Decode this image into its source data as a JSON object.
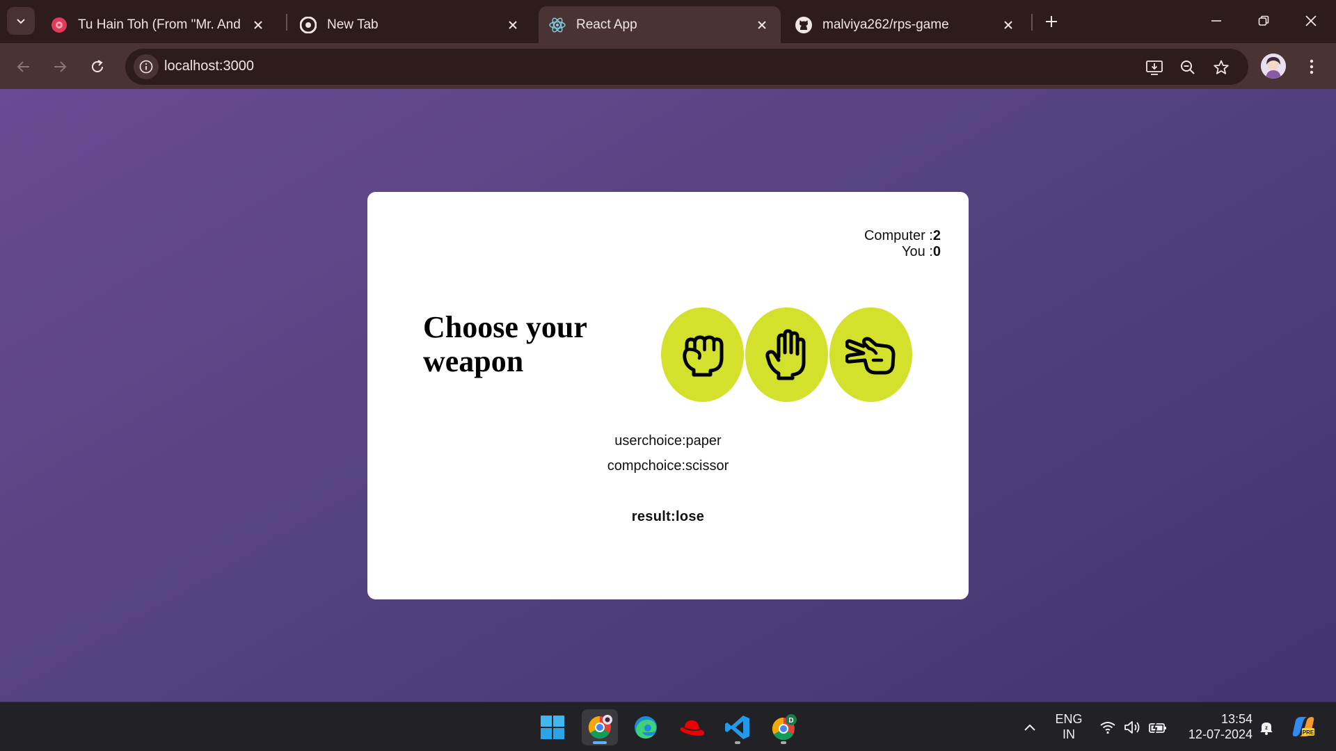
{
  "browser": {
    "tabs": [
      {
        "title": "Tu Hain Toh (From \"Mr. And Mrs. Mahi\")",
        "icon": "music-icon",
        "active": false
      },
      {
        "title": "New Tab",
        "icon": "chrome-icon",
        "active": false
      },
      {
        "title": "React App",
        "icon": "react-icon",
        "active": true
      },
      {
        "title": "malviya262/rps-game",
        "icon": "github-icon",
        "active": false
      }
    ],
    "url": "localhost:3000"
  },
  "game": {
    "score": {
      "computer_label": "Computer :",
      "computer_value": "2",
      "you_label": "You :",
      "you_value": "0"
    },
    "heading": "Choose your weapon",
    "weapons": [
      {
        "name": "rock",
        "icon": "fist-icon"
      },
      {
        "name": "paper",
        "icon": "palm-icon"
      },
      {
        "name": "scissor",
        "icon": "scissors-hand-icon"
      }
    ],
    "user_choice": "userchoice:paper",
    "comp_choice": "compchoice:scissor",
    "result": "result:lose"
  },
  "colors": {
    "weapon_bg": "#d4e12c",
    "page_gradient_start": "#6a4a93",
    "page_gradient_end": "#45336f",
    "browser_frame": "#2e1b1b",
    "toolbar": "#4a3333"
  },
  "taskbar": {
    "apps": [
      "windows-start-icon",
      "chrome-profile-icon",
      "edge-icon",
      "redhat-icon",
      "vscode-icon",
      "chrome-d-icon"
    ],
    "language": "ENG",
    "region": "IN",
    "time": "13:54",
    "date": "12-07-2024"
  }
}
